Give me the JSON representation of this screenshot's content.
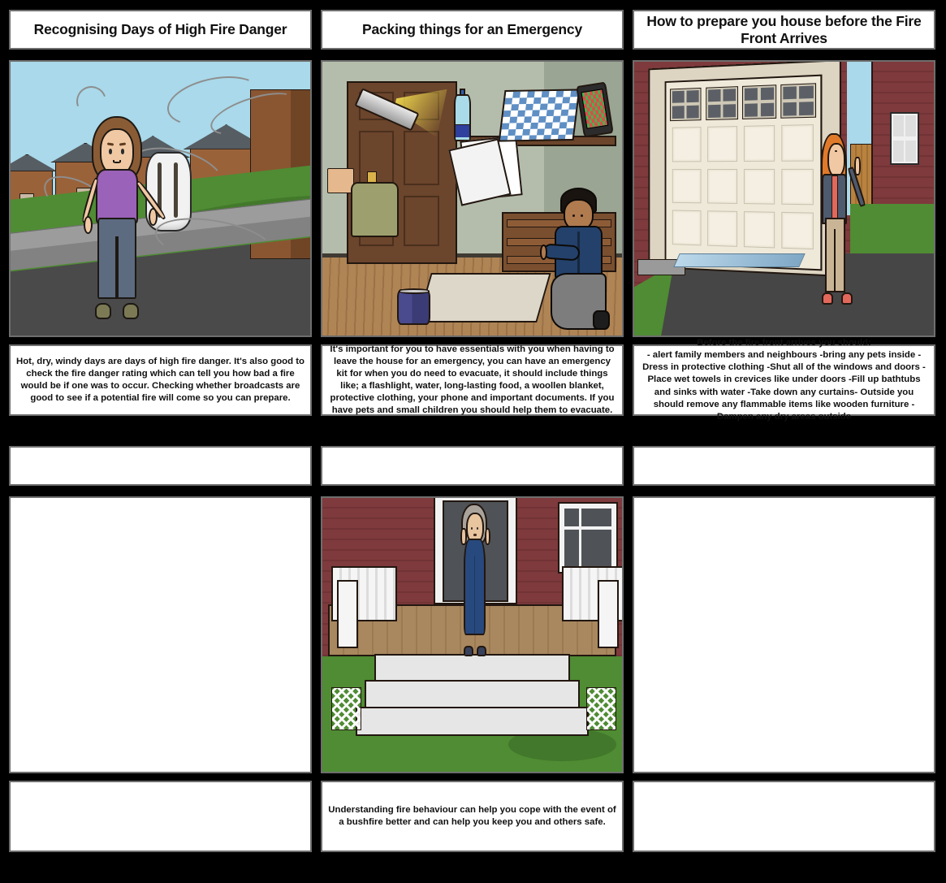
{
  "document": {
    "type": "storyboard",
    "columns": 3,
    "rows": 3,
    "background_color": "#000000",
    "box_border_color": "#6e6e6e",
    "box_fill_color": "#ffffff"
  },
  "cells": [
    {
      "id": "cell-1",
      "title": "Recognising Days of High Fire Danger",
      "caption": "Hot, dry, windy days are days of high fire danger. It's also good to check the fire danger rating which can tell you how bad a fire would be if one was to occur. Checking whether broadcasts are good to see if a potential fire will come so you can prepare.",
      "scene": "windy-suburban-street",
      "scene_description": "A woman with brown hair in a purple top stands on a road in front of a row of brick houses while grey wind swirls blow across a blue sky.",
      "has_illustration": true
    },
    {
      "id": "cell-2",
      "title": "Packing things for an Emergency",
      "caption": "It's important for you to have essentials with you when having to leave the house for an emergency, you can have an emergency kit for when you do need to evacuate, it should include things like; a flashlight, water, long-lasting food, a woollen blanket, protective clothing, your phone and important documents. If you have pets and small children you should help them to evacuate.",
      "scene": "packing-emergency-kit-hallway",
      "scene_description": "A boy kneeling in a hallway by the front door, with a flashlight, water bottle, documents, chequered blanket, smartphone, jacket and a tin of food floating around him.",
      "has_illustration": true
    },
    {
      "id": "cell-3",
      "title": "How to prepare you house before the Fire Front Arrives",
      "caption": "Before the fire front arrives you should:\n- alert family members and neighbours -bring any pets inside -Dress in protective clothing -Shut all of the windows and doors -Place wet towels in crevices like under doors -Fill up bathtubs and sinks with water -Take down any curtains- Outside you should remove any flammable items like wooden furniture -Dampen any dry areas outside",
      "scene": "garage-exterior-wet-driveway",
      "scene_description": "A red-haired woman in a grey jacket stands on a driveway beside a closed cream garage door on a red weatherboard house, with water dampening the driveway.",
      "has_illustration": true
    },
    {
      "id": "cell-4",
      "title": "",
      "caption": "",
      "scene": "",
      "scene_description": "",
      "has_illustration": false
    },
    {
      "id": "cell-5",
      "title": "",
      "caption": "Understanding fire behaviour can help you cope with the event of a bushfire better and can help you keep you and others safe.",
      "scene": "elderly-woman-on-porch",
      "scene_description": "An elderly woman with grey hair in a long blue dress stands on a wooden porch with white railings and steps in front of a dark red house.",
      "has_illustration": true
    },
    {
      "id": "cell-6",
      "title": "",
      "caption": "",
      "scene": "",
      "scene_description": "",
      "has_illustration": false
    }
  ]
}
